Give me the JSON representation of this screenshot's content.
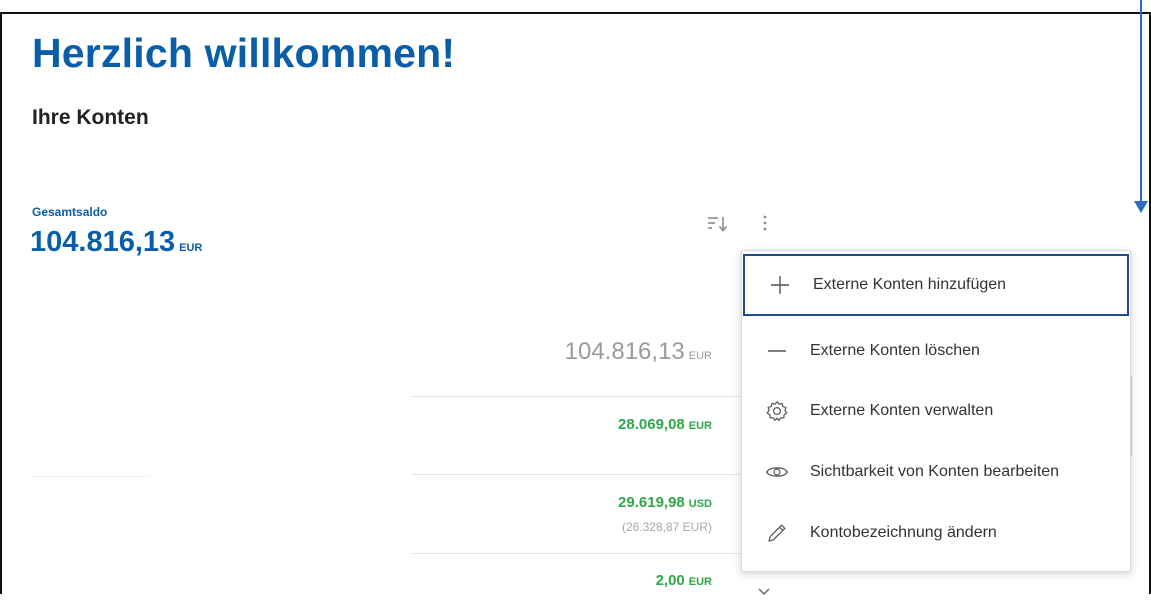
{
  "header": {
    "title": "Herzlich willkommen!",
    "subtitle": "Ihre Konten"
  },
  "total": {
    "label": "Gesamtsaldo",
    "amount": "104.816,13",
    "currency": "EUR"
  },
  "accounts": {
    "sum_amount": "104.816,13",
    "sum_currency": "EUR",
    "rows": [
      {
        "amount": "28.069,08",
        "currency": "EUR"
      },
      {
        "amount": "29.619,98",
        "currency": "USD",
        "converted": "(26.328,87 EUR)"
      },
      {
        "amount": "2,00",
        "currency": "EUR"
      }
    ]
  },
  "menu": {
    "items": [
      {
        "label": "Externe Konten hinzufügen",
        "icon": "plus-icon"
      },
      {
        "label": "Externe Konten löschen",
        "icon": "minus-icon"
      },
      {
        "label": "Externe Konten verwalten",
        "icon": "gear-icon"
      },
      {
        "label": "Sichtbarkeit von Konten bearbeiten",
        "icon": "eye-icon"
      },
      {
        "label": "Kontobezeichnung ändern",
        "icon": "pencil-icon"
      }
    ]
  },
  "colors": {
    "brand": "#0a5da8",
    "positive": "#2ea84a",
    "highlight_border": "#1d4e8c",
    "annotation_arrow": "#2a6cc0"
  }
}
